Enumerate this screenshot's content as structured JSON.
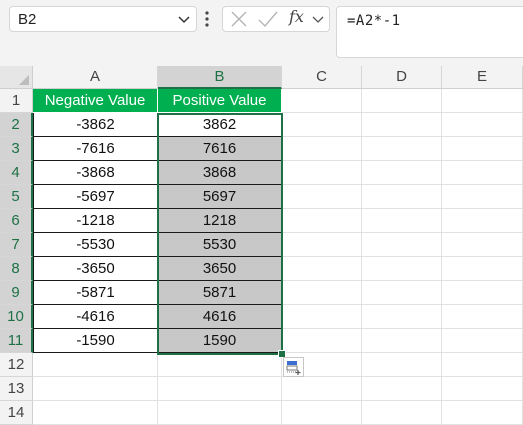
{
  "formula_bar": {
    "name_box": "B2",
    "fx_label": "fx",
    "formula": "=A2*-1"
  },
  "columns": [
    "A",
    "B",
    "C",
    "D",
    "E"
  ],
  "rows": [
    "1",
    "2",
    "3",
    "4",
    "5",
    "6",
    "7",
    "8",
    "9",
    "10",
    "11",
    "12",
    "13",
    "14"
  ],
  "table": {
    "headers": [
      "Negative Value",
      "Positive Value"
    ],
    "negative": [
      "-3862",
      "-7616",
      "-3868",
      "-5697",
      "-1218",
      "-5530",
      "-3650",
      "-5871",
      "-4616",
      "-1590"
    ],
    "positive": [
      "3862",
      "7616",
      "3868",
      "5697",
      "1218",
      "5530",
      "3650",
      "5871",
      "4616",
      "1590"
    ]
  },
  "colors": {
    "header_fill": "#00b050",
    "selection_border": "#1e7145",
    "selection_fill": "#c8c8c8"
  },
  "icons": [
    "chevron-down-icon",
    "more-options-icon",
    "cancel-icon",
    "enter-icon",
    "insert-function-icon",
    "quick-analysis-icon"
  ]
}
